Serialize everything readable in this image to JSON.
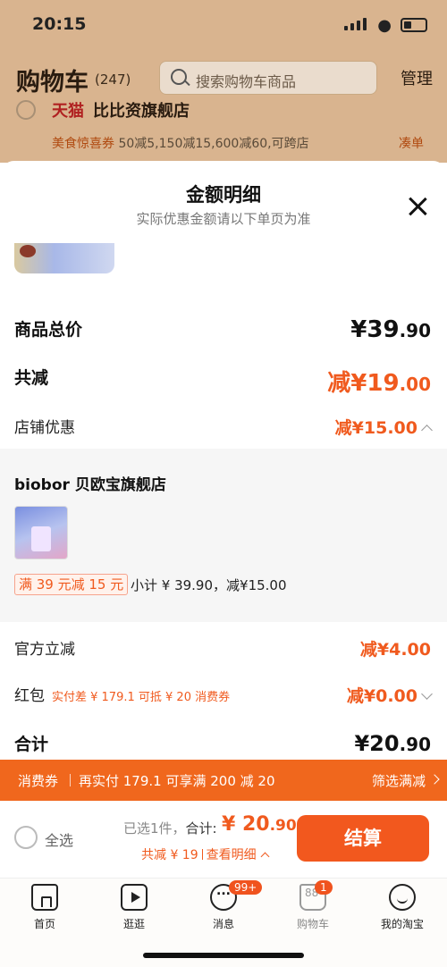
{
  "status": {
    "time": "20:15"
  },
  "header": {
    "title": "购物车",
    "count": "(247)",
    "search_placeholder": "搜索购物车商品",
    "manage": "管理"
  },
  "store_peek": {
    "tmall": "天猫",
    "name": "比比资旗舰店",
    "promo_label": "美食惊喜券",
    "promo_text": "50减5,150减15,600减60,可跨店",
    "cta": "凑单"
  },
  "sheet": {
    "title": "金额明细",
    "subtitle": "实际优惠金额请以下单页为准",
    "goods_total_label": "商品总价",
    "goods_total_int": "¥39",
    "goods_total_dec": ".90",
    "total_disc_label": "共减",
    "total_disc_int": "减¥19",
    "total_disc_dec": ".00",
    "shop_disc_label": "店铺优惠",
    "shop_disc_value": "减¥15.00",
    "store_name": "biobor 贝欧宝旗舰店",
    "store_tag": "满 39 元减 15 元",
    "store_subtotal": "小计 ¥ 39.90，减¥15.00",
    "official_label": "官方立减",
    "official_value": "减¥4.00",
    "hongbao_label": "红包",
    "hongbao_note": "实付差 ¥ 179.1 可抵 ¥ 20 消费券",
    "hongbao_value": "减¥0.00",
    "sum_label": "合计",
    "sum_int": "¥20",
    "sum_dec": ".90"
  },
  "coupon_bar": {
    "label": "消费券",
    "text": "再实付 179.1 可享满 200 减 20",
    "cta": "筛选满减"
  },
  "checkout": {
    "select_all": "全选",
    "selected": "已选1件，",
    "total_label": "合计:",
    "total_int": "¥ 20",
    "total_dec": ".90",
    "discount": "共减 ¥ 19",
    "detail": "查看明细",
    "button": "结算"
  },
  "tabs": [
    {
      "label": "首页"
    },
    {
      "label": "逛逛"
    },
    {
      "label": "消息",
      "badge": "99+"
    },
    {
      "label": "购物车",
      "badge": "1"
    },
    {
      "label": "我的淘宝"
    }
  ],
  "colors": {
    "accent": "#f05a1e",
    "header_bg": "#d9b48f",
    "coupon_bar": "#f0671d"
  }
}
